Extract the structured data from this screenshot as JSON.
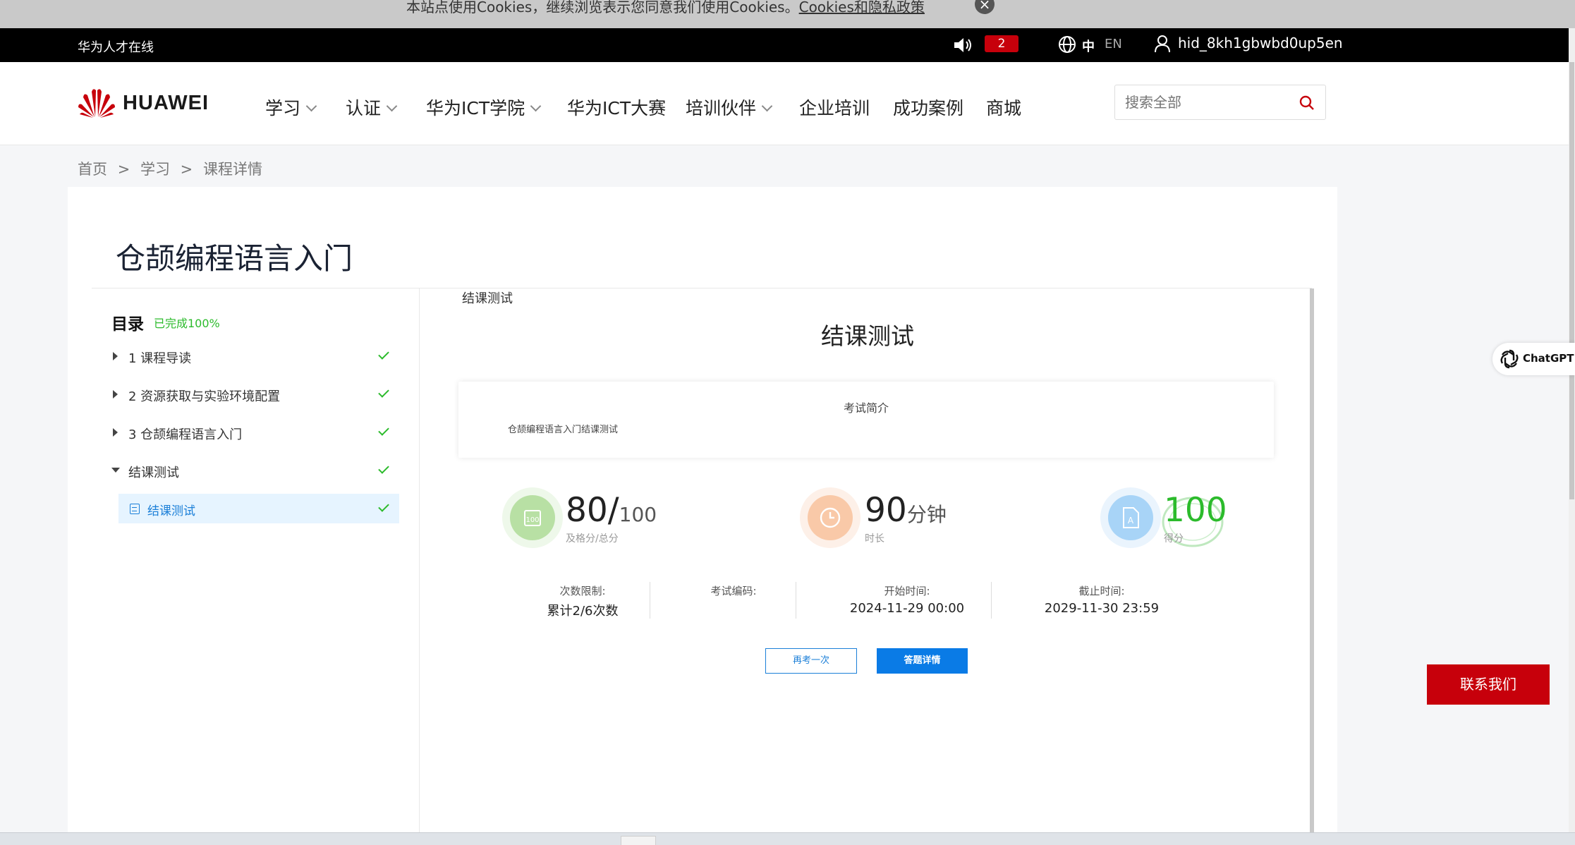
{
  "cookie_bar": {
    "text": "本站点使用Cookies，继续浏览表示您同意我们使用Cookies。",
    "link": "Cookies和隐私政策"
  },
  "topbar": {
    "site_name": "华为人才在线",
    "notification_count": "2",
    "lang_zh": "中",
    "lang_en": "EN",
    "username": "hid_8kh1gbwbd0up5en"
  },
  "nav": {
    "logo_text": "HUAWEI",
    "items": [
      {
        "label": "学习",
        "dropdown": true
      },
      {
        "label": "认证",
        "dropdown": true
      },
      {
        "label": "华为ICT学院",
        "dropdown": true
      },
      {
        "label": "华为ICT大赛",
        "dropdown": false
      },
      {
        "label": "培训伙伴",
        "dropdown": true
      },
      {
        "label": "企业培训",
        "dropdown": false
      },
      {
        "label": "成功案例",
        "dropdown": false
      },
      {
        "label": "商城",
        "dropdown": false
      }
    ],
    "search_placeholder": "搜索全部"
  },
  "breadcrumb": [
    "首页",
    ">",
    "学习",
    ">",
    "课程详情"
  ],
  "course": {
    "title": "仓颉编程语言入门"
  },
  "toc": {
    "title": "目录",
    "progress": "已完成100%",
    "items": [
      {
        "label": "1 课程导读",
        "expanded": false,
        "completed": true
      },
      {
        "label": "2 资源获取与实验环境配置",
        "expanded": false,
        "completed": true
      },
      {
        "label": "3 仓颉编程语言入门",
        "expanded": false,
        "completed": true
      },
      {
        "label": "结课测试",
        "expanded": true,
        "completed": true
      }
    ],
    "sub_item": {
      "label": "结课测试",
      "completed": true
    }
  },
  "exam": {
    "section_label": "结课测试",
    "title": "结课测试",
    "intro_heading": "考试简介",
    "intro_text": "仓颉编程语言入门结课测试",
    "stats": {
      "pass_score": "80/",
      "total_score": "100",
      "pass_label": "及格分/总分",
      "duration": "90",
      "duration_unit": "分钟",
      "duration_label": "时长",
      "score": "100",
      "score_label": "得分"
    },
    "info": {
      "attempts_label": "次数限制:",
      "attempts_value": "累计2/6次数",
      "code_label": "考试编码:",
      "code_value": "",
      "start_label": "开始时间:",
      "start_value": "2024-11-29 00:00",
      "end_label": "截止时间:",
      "end_value": "2029-11-30 23:59"
    },
    "buttons": {
      "retry": "再考一次",
      "detail": "答题详情"
    }
  },
  "side_widgets": {
    "chatgpt_label": "ChatGPT",
    "contact_label": "联系我们"
  },
  "colors": {
    "brand_red": "#c7000b",
    "link_blue": "#1b7fd8",
    "success_green": "#2cbb2c"
  }
}
